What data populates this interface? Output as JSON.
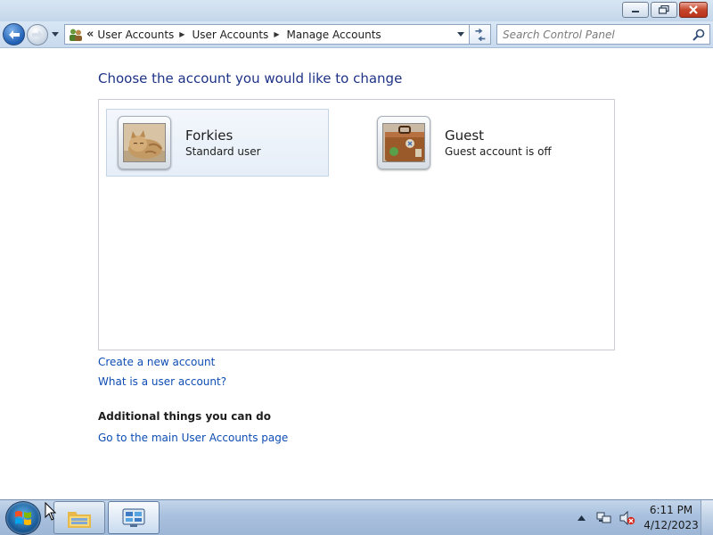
{
  "window": {
    "caption_buttons": {
      "minimize": "minimize-icon",
      "maximize": "restore-icon",
      "close": "close-icon"
    }
  },
  "navbar": {
    "back_icon": "arrow-left-icon",
    "forward_icon": "arrow-right-icon",
    "address_icon": "user-accounts-icon",
    "overflow": "«",
    "breadcrumbs": [
      {
        "label": "User Accounts"
      },
      {
        "label": "User Accounts"
      },
      {
        "label": "Manage Accounts"
      }
    ],
    "refresh_icon": "refresh-icon",
    "search": {
      "placeholder": "Search Control Panel",
      "value": ""
    }
  },
  "main": {
    "title": "Choose the account you would like to change",
    "accounts": [
      {
        "name": "Forkies",
        "type": "Standard user",
        "picture": "kitten-photo",
        "selected": true
      },
      {
        "name": "Guest",
        "type": "Guest account is off",
        "picture": "suitcase-icon",
        "selected": false
      }
    ],
    "links": {
      "create": "Create a new account",
      "what_is": "What is a user account?"
    },
    "additional": {
      "heading": "Additional things you can do",
      "link": "Go to the main User Accounts page"
    }
  },
  "taskbar": {
    "start_icon": "windows-logo-icon",
    "pinned": [
      "explorer-icon",
      "control-panel-icon"
    ],
    "tray": {
      "icons": [
        "show-hidden-icons-arrow",
        "network-icon",
        "volume-muted-icon"
      ],
      "time": "6:11 PM",
      "date": "4/12/2023"
    }
  },
  "colors": {
    "title_text": "#1e3287",
    "link": "#0e4db3",
    "titlebar": "#c3d6ea"
  }
}
